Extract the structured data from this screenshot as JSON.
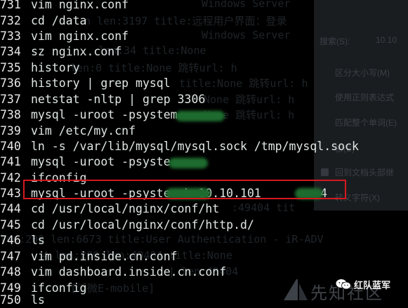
{
  "ghost_lines": [
    "Windows Server",
    "n len:3197   title:远程用户界面：登录",
    "Windows Server",
    "len:34       title:None",
    "len:0       title:None 跳转url: h",
    "title:None 跳转url: h",
    "None 跳转url: h",
    "None 跳转url: h",
    ":49404  tit",
    "len:200 len:6673   title:User Authentication - iR-ADV",
    "4 len:200 len:49404  title:None",
    "|  len:49404",
    "[泛微E-mobile]"
  ],
  "find_panel": {
    "search_label": "搜索(S):",
    "search_value": "10.10",
    "options": [
      "区分大小写(M)",
      "使用正则表达式",
      "匹配整个单词(E)",
      "索(B)",
      "回到文档头部继",
      "转义字符(X)"
    ]
  },
  "history": [
    {
      "num": "731",
      "cmd": "vim nginx.conf"
    },
    {
      "num": "732",
      "cmd": "cd /data"
    },
    {
      "num": "733",
      "cmd": "vim nginx.conf"
    },
    {
      "num": "734",
      "cmd": "sz nginx.conf"
    },
    {
      "num": "735",
      "cmd": "history"
    },
    {
      "num": "736",
      "cmd": "history | grep mysql"
    },
    {
      "num": "737",
      "cmd": "netstat -nltp | grep 3306"
    },
    {
      "num": "738",
      "cmd": "mysql -uroot -psystem"
    },
    {
      "num": "739",
      "cmd": "vim /etc/my.cnf"
    },
    {
      "num": "740",
      "cmd": "ln -s /var/lib/mysql/mysql.sock /tmp/mysql.sock"
    },
    {
      "num": "741",
      "cmd": "mysql -uroot -psyste"
    },
    {
      "num": "742",
      "cmd": "ifconfig"
    },
    {
      "num": "743",
      "cmd": "mysql -uroot -psyste        -h 10.10.101"
    },
    {
      "num": "744",
      "cmd": "cd /usr/local/nginx/conf/ht"
    },
    {
      "num": "745",
      "cmd": "cd /usr/local/nginx/conf/http.d/"
    },
    {
      "num": "746",
      "cmd": "ls"
    },
    {
      "num": "747",
      "cmd": "vim pd.inside.cn.conf"
    },
    {
      "num": "748",
      "cmd": "vim dashboard.inside.cn.conf"
    },
    {
      "num": "749",
      "cmd": "ifconfig"
    },
    {
      "num": "750",
      "cmd": "ls"
    }
  ],
  "line_743_suffix": "4",
  "watermark": {
    "text": "先知社区",
    "brand": "红队蓝军"
  },
  "colors": {
    "background": "#000000",
    "text": "#dfe7e4",
    "highlight": "#d4191f",
    "redaction": "#1d6b2e"
  }
}
